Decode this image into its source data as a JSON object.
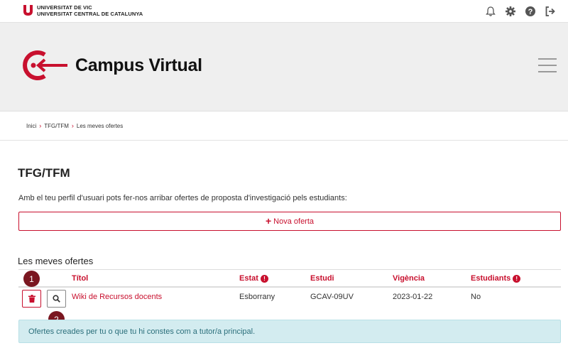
{
  "topbar": {
    "institution_line1": "UNIVERSITAT DE VIC",
    "institution_line2": "UNIVERSITAT CENTRAL DE CATALUNYA",
    "icons": [
      "bell-icon",
      "gear-icon",
      "help-icon",
      "logout-icon"
    ]
  },
  "header": {
    "site_title": "Campus Virtual"
  },
  "breadcrumb": [
    "Inici",
    "TFG/TFM",
    "Les meves ofertes"
  ],
  "page": {
    "title": "TFG/TFM",
    "intro": "Amb el teu perfil d'usuari pots fer-nos arribar ofertes de proposta d'investigació pels estudiants:",
    "new_offer_label": "Nova oferta",
    "section_title": "Les meves ofertes"
  },
  "table": {
    "columns": {
      "title": "Títol",
      "status": "Estat",
      "study": "Estudi",
      "validity": "Vigència",
      "students": "Estudiants"
    },
    "rows": [
      {
        "title": "Wiki de Recursos docents",
        "status": "Esborrany",
        "study": "GCAV-09UV",
        "validity": "2023-01-22",
        "students": "No"
      }
    ]
  },
  "markers": [
    "1",
    "2"
  ],
  "note": "Ofertes creades per tu o que tu hi constes com a tutor/a principal.",
  "colors": {
    "accent": "#c8102e",
    "header_bg": "#efefef",
    "note_bg": "#d3ecf0",
    "marker": "#7a1620"
  }
}
